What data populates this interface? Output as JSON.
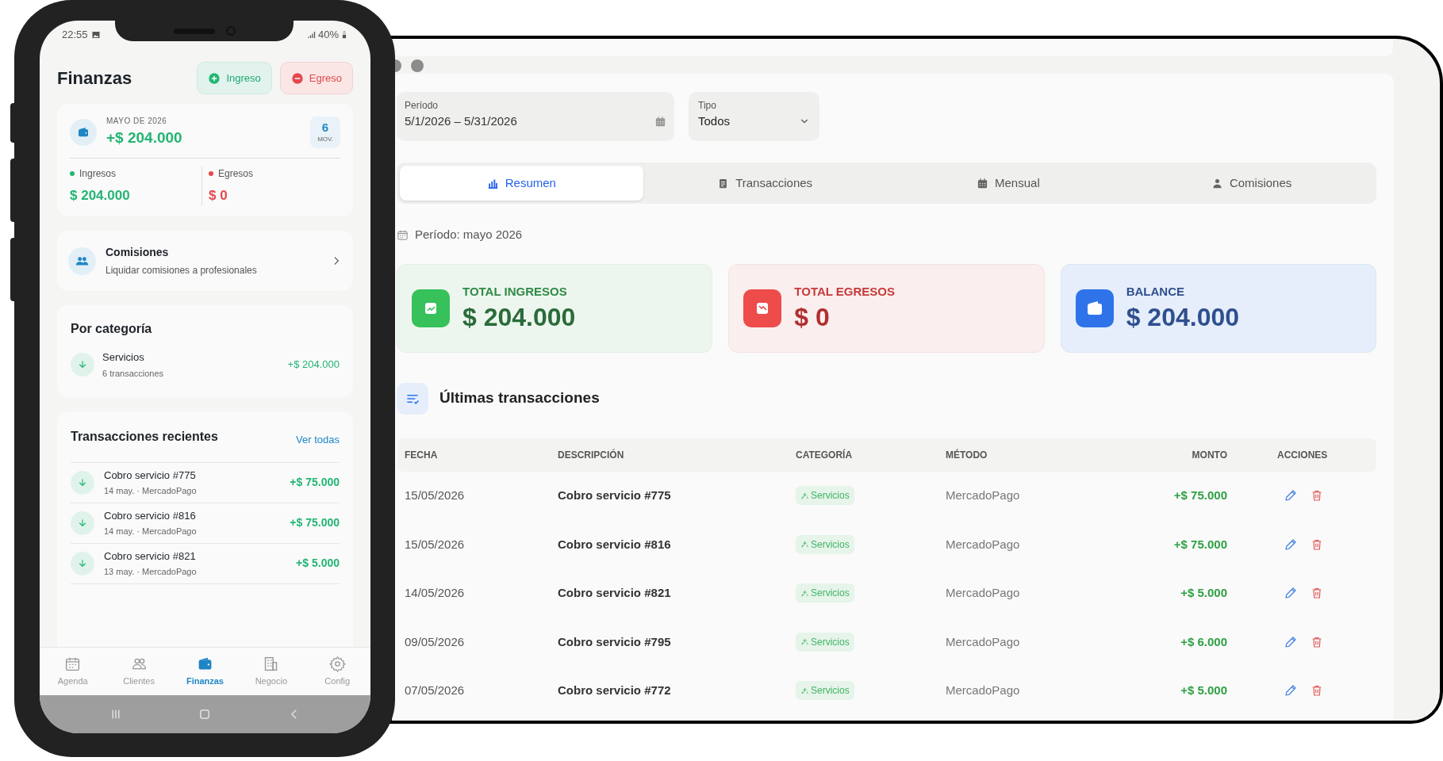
{
  "phone": {
    "status_bar": {
      "time": "22:55",
      "battery": "40%"
    },
    "title": "Finanzas",
    "actions": [
      {
        "label": "Ingreso",
        "kind": "income"
      },
      {
        "label": "Egreso",
        "kind": "expense"
      }
    ],
    "summary": {
      "period": "MAYO DE 2026",
      "total": "+$ 204.000",
      "count": "6",
      "count_label": "MOV.",
      "breakdown": [
        {
          "label": "Ingresos",
          "value": "$ 204.000",
          "color": "#22b573"
        },
        {
          "label": "Egresos",
          "value": "$ 0",
          "color": "#e5484d"
        }
      ]
    },
    "commissions": {
      "title": "Comisiones",
      "subtitle": "Liquidar comisiones a profesionales"
    },
    "by_category": {
      "title": "Por categoría",
      "items": [
        {
          "name": "Servicios",
          "count": "6 transacciones",
          "amount": "+$ 204.000"
        }
      ]
    },
    "recent": {
      "title": "Transacciones recientes",
      "link": "Ver todas",
      "items": [
        {
          "name": "Cobro servicio #775",
          "meta": "14 may. · MercadoPago",
          "amount": "+$ 75.000"
        },
        {
          "name": "Cobro servicio #816",
          "meta": "14 may. · MercadoPago",
          "amount": "+$ 75.000"
        },
        {
          "name": "Cobro servicio #821",
          "meta": "13 may. · MercadoPago",
          "amount": "+$ 5.000"
        }
      ]
    },
    "bottom_nav": [
      {
        "label": "Agenda",
        "selected": false
      },
      {
        "label": "Clientes",
        "selected": false
      },
      {
        "label": "Finanzas",
        "selected": true
      },
      {
        "label": "Negocio",
        "selected": false
      },
      {
        "label": "Config",
        "selected": false
      }
    ]
  },
  "desktop": {
    "filters": {
      "period": {
        "label": "Período",
        "value": "5/1/2026 – 5/31/2026"
      },
      "type": {
        "label": "Tipo",
        "value": "Todos"
      }
    },
    "tabs": [
      {
        "label": "Resumen",
        "selected": true
      },
      {
        "label": "Transacciones",
        "selected": false
      },
      {
        "label": "Mensual",
        "selected": false
      },
      {
        "label": "Comisiones",
        "selected": false
      }
    ],
    "period_note": "Período: mayo 2026",
    "cards": [
      {
        "kind": "income",
        "label": "TOTAL INGRESOS",
        "value": "$ 204.000"
      },
      {
        "kind": "expense",
        "label": "TOTAL EGRESOS",
        "value": "$ 0"
      },
      {
        "kind": "balance",
        "label": "BALANCE",
        "value": "$ 204.000"
      }
    ],
    "section_title": "Últimas transacciones",
    "table": {
      "columns": [
        "FECHA",
        "DESCRIPCIÓN",
        "CATEGORÍA",
        "MÉTODO",
        "MONTO",
        "ACCIONES"
      ],
      "rows": [
        {
          "date": "15/05/2026",
          "description": "Cobro servicio #775",
          "category": "Servicios",
          "method": "MercadoPago",
          "amount": "+$ 75.000"
        },
        {
          "date": "15/05/2026",
          "description": "Cobro servicio #816",
          "category": "Servicios",
          "method": "MercadoPago",
          "amount": "+$ 75.000"
        },
        {
          "date": "14/05/2026",
          "description": "Cobro servicio #821",
          "category": "Servicios",
          "method": "MercadoPago",
          "amount": "+$ 5.000"
        },
        {
          "date": "09/05/2026",
          "description": "Cobro servicio #795",
          "category": "Servicios",
          "method": "MercadoPago",
          "amount": "+$ 6.000"
        },
        {
          "date": "07/05/2026",
          "description": "Cobro servicio #772",
          "category": "Servicios",
          "method": "MercadoPago",
          "amount": "+$ 5.000"
        }
      ]
    }
  }
}
